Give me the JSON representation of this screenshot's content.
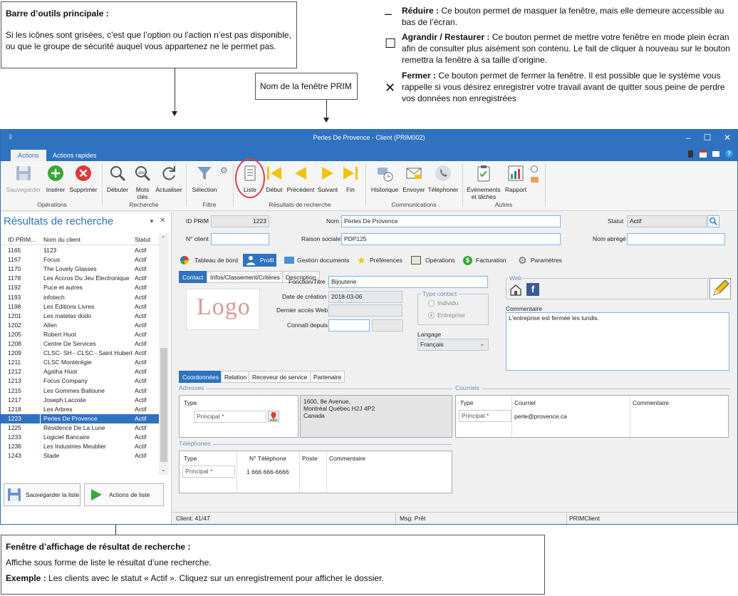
{
  "callouts": {
    "toolbar": {
      "title": "Barre d’outils principale :",
      "body": "Si les icônes sont grisées, c’est que l’option ou l’action n’est pas disponible, ou que le groupe de sécurité auquel vous appartenez ne le permet pas."
    },
    "window_name": "Nom de la fenêtre PRIM",
    "results": {
      "title": "Fenêtre d’affichage de résultat de recherche :",
      "body": "Affiche sous forme de liste le résultat d’une recherche.",
      "example_label": "Exemple :",
      "example_body": "Les clients avec le statut « Actif ». Cliquez sur un enregistrement pour afficher le dossier."
    },
    "reduce": {
      "glyph": "–",
      "title": "Réduire :",
      "body": "Ce bouton permet de masquer la fenêtre, mais elle demeure accessible au bas de l’écran."
    },
    "maximize": {
      "glyph": "☐",
      "title": "Agrandir / Restaurer :",
      "body": "Ce bouton permet de mettre votre fenêtre en mode plein écran afin de consulter plus aisément son contenu. Le fait de cliquer à nouveau sur le bouton remettra la fenêtre à sa taille d’origine."
    },
    "close": {
      "glyph": "✕",
      "title": "Fermer :",
      "body": "Ce bouton permet de fermer la fenêtre. Il est possible que le système vous rappelle si vous désirez enregistrer votre travail avant de quitter sous peine de perdre vos données non enregistrées"
    }
  },
  "window": {
    "title": "Perles De Provence - Client (PRIM002)",
    "menu_tabs": [
      "Actions",
      "Actions rapides"
    ]
  },
  "ribbon": {
    "buttons": {
      "save": "Sauvegarder",
      "insert": "Insérer",
      "delete": "Supprimer",
      "start": "Débuter",
      "keywords": "Mots clés",
      "refresh": "Actualiser",
      "selection": "Sélection",
      "list": "Liste",
      "first": "Début",
      "prev": "Précédent",
      "next": "Suivant",
      "last": "Fin",
      "history": "Historique",
      "send": "Envoyer",
      "phone": "Téléphoner",
      "events": "Évènements et tâches",
      "report": "Rapport"
    },
    "groups": {
      "operations": "Opérations",
      "search": "Recherche",
      "filter": "Filtre",
      "results": "Résultats de recherche",
      "communications": "Communications",
      "others": "Autres"
    },
    "icon_colors": {
      "insert": "#3aa835",
      "delete": "#e03a3a",
      "nav": "#f4c20d",
      "accent": "#2e72c0"
    }
  },
  "results_panel": {
    "title": "Résultats de recherche",
    "columns": [
      "ID PRIM...",
      "Nom du client",
      "Statut"
    ],
    "rows": [
      [
        "1165",
        "1123",
        "Actif"
      ],
      [
        "1167",
        "Focus",
        "Actif"
      ],
      [
        "1170",
        "The Lovely Glasses",
        "Actif"
      ],
      [
        "1178",
        "Les Accros Du Jeu Électronique",
        "Actif"
      ],
      [
        "1192",
        "Puce et autres",
        "Actif"
      ],
      [
        "1193",
        "infotech",
        "Actif"
      ],
      [
        "1198",
        "Les Éditions Livres",
        "Actif"
      ],
      [
        "1201",
        "Les matelas dodo",
        "Actif"
      ],
      [
        "1202",
        "Allen",
        "Actif"
      ],
      [
        "1205",
        "Robert Huot",
        "Actif"
      ],
      [
        "1208",
        "Centre De Services",
        "Actif"
      ],
      [
        "1209",
        "CLSC- SH - CLSC - Saint Hubert",
        "Actif"
      ],
      [
        "1211",
        "CLSC Montérégie",
        "Actif"
      ],
      [
        "1212",
        "Agatha Huot",
        "Actif"
      ],
      [
        "1213",
        "Focus Company",
        "Actif"
      ],
      [
        "1215",
        "Les Gommes Balloune",
        "Actif"
      ],
      [
        "1217",
        "Joseph Lacoste",
        "Actif"
      ],
      [
        "1218",
        "Les Arbres",
        "Actif"
      ],
      [
        "1223",
        "Perles De Provence",
        "Actif"
      ],
      [
        "1225",
        "Résidence De La Lune",
        "Actif"
      ],
      [
        "1233",
        "Logiciel Bancaire",
        "Actif"
      ],
      [
        "1236",
        "Les Industries Meublier",
        "Actif"
      ],
      [
        "1243",
        "Stade",
        "Actif"
      ]
    ],
    "selected_index": 18,
    "save_list": "Sauvegarder la liste",
    "list_actions": "Actions de liste"
  },
  "form": {
    "labels": {
      "id_prim": "ID PRIM",
      "client_no": "N° client",
      "name": "Nom",
      "business_name": "Raison sociale",
      "status": "Statut",
      "short_name": "Nom abrégé"
    },
    "values": {
      "id_prim": "1223",
      "name": "Perles De Provence",
      "business_name": "PDP125",
      "status": "Actif"
    },
    "main_tabs": [
      "Tableau de bord",
      "Profil",
      "Gestion documents",
      "Préférences",
      "Opérations",
      "Facturation",
      "Paramètres"
    ],
    "sub_tabs": [
      "Contact",
      "Infos/Classement/Critères",
      "Description"
    ],
    "logo_text": "Logo",
    "contact": {
      "function_label": "Fonction/Titre",
      "function_value": "Bijouterie",
      "created_label": "Date de création",
      "created_value": "2018-03-06",
      "web_access_label": "Dernier accès Web",
      "known_since_label": "Connaît depuis",
      "contact_type_legend": "Type contact",
      "type_individual": "Individu",
      "type_company": "Entreprise",
      "language_label": "Langage",
      "language_value": "Français",
      "web_legend": "Web",
      "comment_label": "Commentaire",
      "comment_value": "L'entreprise est fermée les lundis."
    },
    "coord_tabs": [
      "Coordonnées",
      "Relation",
      "Receveur de service",
      "Partenaire"
    ],
    "addresses": {
      "legend": "Adresses",
      "type_header": "Type",
      "type_value": "Principal *",
      "line1": "1600, 8e Avenue,",
      "line2": "Montréal Québec H2J 4P2",
      "line3": "Canada"
    },
    "emails": {
      "legend": "Courriels",
      "headers": [
        "Type",
        "Courriel",
        "Commentaire"
      ],
      "type_value": "Principal *",
      "email": "perle@provence.ca"
    },
    "phones": {
      "legend": "Téléphones",
      "headers": [
        "Type",
        "N° Téléphone",
        "Poste",
        "Commentaire"
      ],
      "type_value": "Principal *",
      "number": "1 666 666-6666"
    }
  },
  "statusbar": {
    "client": "Client: 41/47",
    "msg": "Msg: Prêt",
    "app": "PRIMClient"
  }
}
